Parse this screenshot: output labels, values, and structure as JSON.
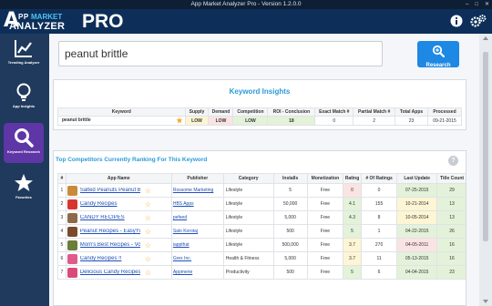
{
  "window": {
    "title": "App Market Analyzer Pro  - Version 1.2.0.0"
  },
  "logo": {
    "a": "A",
    "pp": "PP",
    "market": "MARKET",
    "analyzer": "ANALYZER",
    "pro": "PRO"
  },
  "header": {
    "info_icon": "info-icon",
    "settings_icon": "gears-icon"
  },
  "sidebar": {
    "items": [
      {
        "label": "Trending Analyzer",
        "icon": "chart-line-icon",
        "active": false
      },
      {
        "label": "App Insights",
        "icon": "lightbulb-icon",
        "active": false
      },
      {
        "label": "Keyword Research",
        "icon": "search-icon",
        "active": true
      },
      {
        "label": "Favorites",
        "icon": "star-icon",
        "active": false
      }
    ]
  },
  "search": {
    "value": "peanut brittle",
    "placeholder": "",
    "button_label": "Research"
  },
  "insights": {
    "title": "Keyword Insights",
    "columns": [
      "Keyword",
      "Supply",
      "Demand",
      "Competition",
      "ROI - Conclusion",
      "Exact Match #",
      "Partial Match #",
      "Total Apps",
      "Processed"
    ],
    "row": {
      "keyword": "peanut brittle",
      "supply": "LOW",
      "demand": "LOW",
      "competition": "LOW",
      "roi": "18",
      "exact": "0",
      "partial": "2",
      "total": "23",
      "processed": "09-21-2015"
    }
  },
  "competitors": {
    "title": "Top Competitors Currently Ranking For This Keyword",
    "columns": [
      "#",
      "App Name",
      "Publisher",
      "Category",
      "Installs",
      "Monetization",
      "Rating",
      "# Of Ratings",
      "Last Update",
      "Title Count"
    ],
    "rows": [
      {
        "n": "1",
        "name": "Salted Peanuts Peanut Br",
        "publisher": "Rossome Marketing",
        "category": "Lifestyle",
        "installs": "5",
        "monetization": "Free",
        "rating": "0",
        "ratings": "0",
        "update": "07-25-2015",
        "title_count": "29",
        "icon_color": "#c98a3a"
      },
      {
        "n": "2",
        "name": "Candy Recipes",
        "publisher": "HBS Apps",
        "category": "Lifestyle",
        "installs": "50,000",
        "monetization": "Free",
        "rating": "4.1",
        "ratings": "155",
        "update": "10-21-2014",
        "title_count": "13",
        "icon_color": "#d6362f"
      },
      {
        "n": "3",
        "name": "CANDY RECIPES",
        "publisher": "pefeed",
        "category": "Lifestyle",
        "installs": "5,000",
        "monetization": "Free",
        "rating": "4.3",
        "ratings": "8",
        "update": "10-05-2014",
        "title_count": "13",
        "icon_color": "#8f6a4a"
      },
      {
        "n": "4",
        "name": "Peanut Recipes - EasyYun",
        "publisher": "Salo Korotaj",
        "category": "Lifestyle",
        "installs": "500",
        "monetization": "Free",
        "rating": "5",
        "ratings": "1",
        "update": "04-22-2015",
        "title_count": "26",
        "icon_color": "#7a4a2a"
      },
      {
        "n": "5",
        "name": "Mom's Best Recipes - Vol",
        "publisher": "iappthat",
        "category": "Lifestyle",
        "installs": "500,000",
        "monetization": "Free",
        "rating": "3.7",
        "ratings": "270",
        "update": "04-05-2011",
        "title_count": "16",
        "icon_color": "#6b7d3a"
      },
      {
        "n": "6",
        "name": "Candy Recipes !!",
        "publisher": "Grex Inc.",
        "category": "Health & Fitness",
        "installs": "5,000",
        "monetization": "Free",
        "rating": "3.7",
        "ratings": "11",
        "update": "05-13-2015",
        "title_count": "16",
        "icon_color": "#e05a8c"
      },
      {
        "n": "7",
        "name": "Delicious Candy Recipes",
        "publisher": "Appmerie",
        "category": "Productivity",
        "installs": "500",
        "monetization": "Free",
        "rating": "5",
        "ratings": "6",
        "update": "04-04-2015",
        "title_count": "23",
        "icon_color": "#d94a7a"
      }
    ]
  },
  "colors": {
    "accent": "#1e88e5",
    "active_nav": "#5e36a6",
    "header": "#0d2e58",
    "title_blue": "#2b9bd6"
  }
}
